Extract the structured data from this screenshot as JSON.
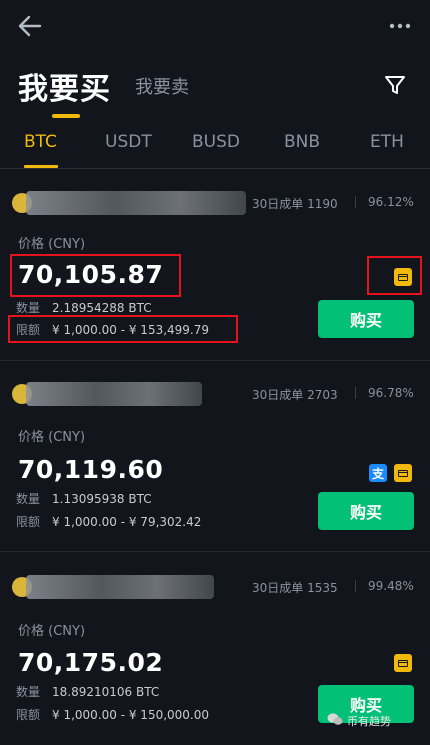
{
  "header": {
    "buy_title": "我要买",
    "sell_title": "我要卖"
  },
  "tabs": [
    "BTC",
    "USDT",
    "BUSD",
    "BNB",
    "ETH"
  ],
  "labels": {
    "price_label": "价格 (CNY)",
    "quantity": "数量",
    "limit": "限额",
    "buy_button": "购买"
  },
  "listings": [
    {
      "orders": "30日成单 1190",
      "completion": "96.12%",
      "price": "70,105.87",
      "quantity": "2.18954288 BTC",
      "limit": "¥ 1,000.00 - ¥ 153,499.79",
      "payment_methods": [
        "bank-card"
      ]
    },
    {
      "orders": "30日成单 2703",
      "completion": "96.78%",
      "price": "70,119.60",
      "quantity": "1.13095938 BTC",
      "limit": "¥ 1,000.00 - ¥ 79,302.42",
      "payment_methods": [
        "alipay",
        "bank-card"
      ],
      "alipay_glyph": "支"
    },
    {
      "orders": "30日成单 1535",
      "completion": "99.48%",
      "price": "70,175.02",
      "quantity": "18.89210106 BTC",
      "limit": "¥ 1,000.00 - ¥ 150,000.00",
      "payment_methods": [
        "bank-card"
      ]
    }
  ],
  "watermark": "币有趋势",
  "colors": {
    "accent": "#f0b90b",
    "buy_green": "#02c076",
    "highlight_red": "#e3141b",
    "background": "#12161c"
  }
}
